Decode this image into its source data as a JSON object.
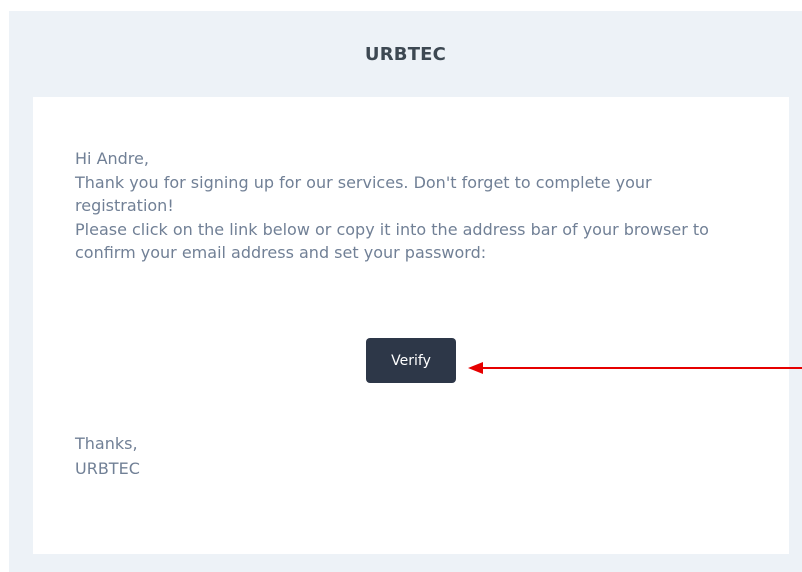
{
  "header": {
    "brand": "URBTEC"
  },
  "message": {
    "greeting": "Hi Andre,",
    "line1": "Thank you for signing up for our services. Don't forget to complete your registration!",
    "line2": "Please click on the link below or copy it into the address bar of your browser to confirm your email address and set your password:"
  },
  "cta": {
    "label": "Verify"
  },
  "signoff": {
    "thanks": "Thanks,",
    "name": "URBTEC"
  },
  "colors": {
    "frame_background": "#edf2f7",
    "card_background": "#ffffff",
    "body_text": "#718096",
    "brand_text": "#3d4852",
    "button_background": "#2d3748",
    "annotation_arrow": "#e60000"
  },
  "icons": {
    "annotation": "red-arrow-pointing-left"
  }
}
